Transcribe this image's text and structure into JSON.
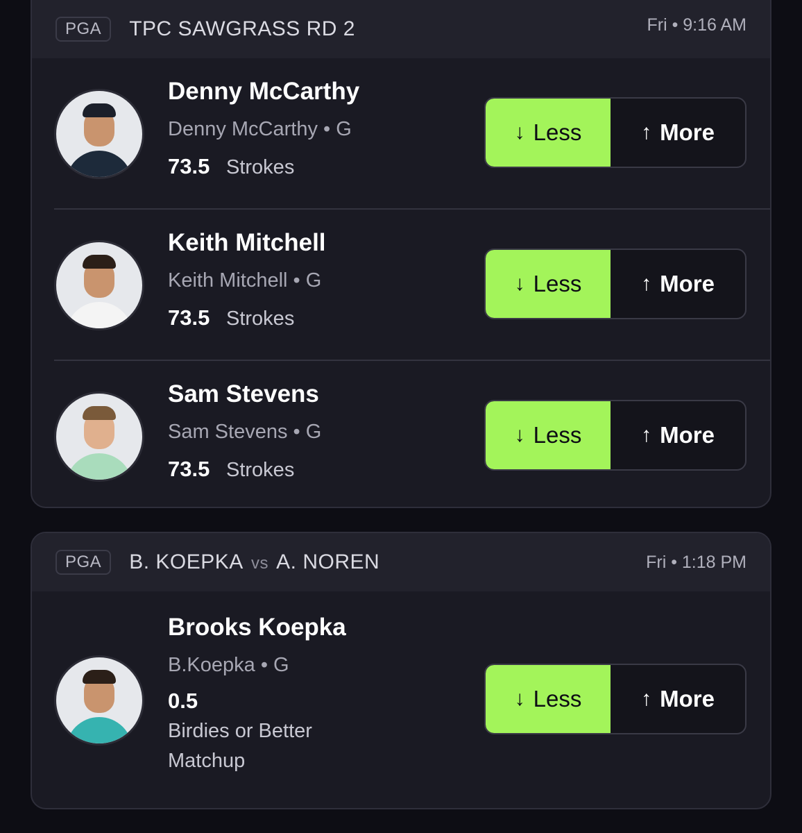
{
  "colors": {
    "accent": "#a3f45a",
    "card_bg": "#1a1a23",
    "page_bg": "#0d0d14"
  },
  "cards": [
    {
      "league": "PGA",
      "title": "TPC SAWGRASS RD 2",
      "time": "Fri • 9:16 AM",
      "rows": [
        {
          "name": "Denny McCarthy",
          "sub": "Denny McCarthy • G",
          "line": "73.5",
          "unit": "Strokes",
          "less": "Less",
          "more": "More"
        },
        {
          "name": "Keith Mitchell",
          "sub": "Keith Mitchell • G",
          "line": "73.5",
          "unit": "Strokes",
          "less": "Less",
          "more": "More"
        },
        {
          "name": "Sam Stevens",
          "sub": "Sam Stevens • G",
          "line": "73.5",
          "unit": "Strokes",
          "less": "Less",
          "more": "More"
        }
      ]
    },
    {
      "league": "PGA",
      "title_left": "B. KOEPKA",
      "title_vs": "vs",
      "title_right": "A. NOREN",
      "time": "Fri • 1:18 PM",
      "rows": [
        {
          "name": "Brooks Koepka",
          "sub": "B.Koepka • G",
          "line": "0.5",
          "unit_line1": "Birdies or Better",
          "unit_line2": "Matchup",
          "less": "Less",
          "more": "More"
        }
      ]
    }
  ],
  "icons": {
    "less": "arrow-down-icon",
    "more": "arrow-up-icon"
  }
}
